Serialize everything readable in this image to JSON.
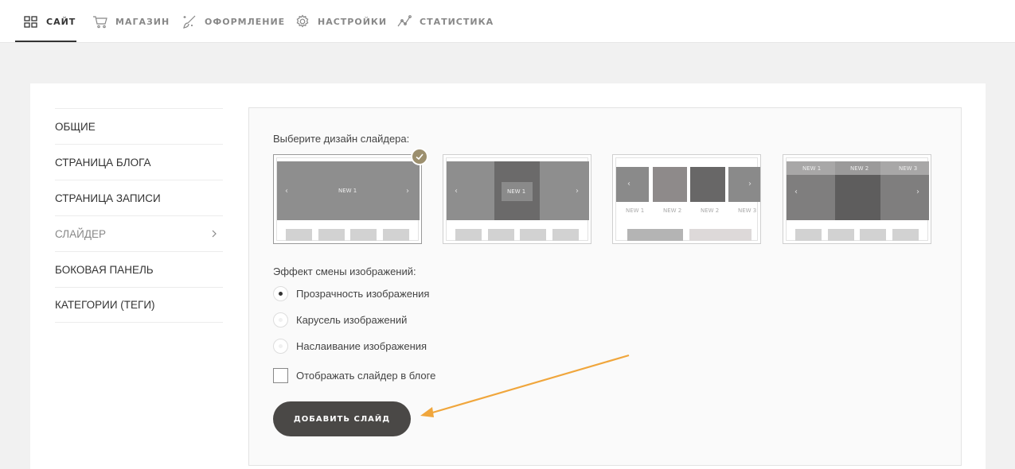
{
  "topnav": {
    "items": [
      {
        "label": "САЙТ",
        "icon": "grid-icon"
      },
      {
        "label": "МАГАЗИН",
        "icon": "cart-icon"
      },
      {
        "label": "ОФОРМЛЕНИЕ",
        "icon": "magic-brush-icon"
      },
      {
        "label": "НАСТРОЙКИ",
        "icon": "gear-icon"
      },
      {
        "label": "СТАТИСТИКА",
        "icon": "line-chart-icon"
      }
    ],
    "active": "САЙТ"
  },
  "sidebar": {
    "items": [
      {
        "label": "ОБЩИЕ"
      },
      {
        "label": "СТРАНИЦА БЛОГА"
      },
      {
        "label": "СТРАНИЦА ЗАПИСИ"
      },
      {
        "label": "СЛАЙДЕР",
        "active": true
      },
      {
        "label": "БОКОВАЯ ПАНЕЛЬ"
      },
      {
        "label": "КАТЕГОРИИ (ТЕГИ)"
      }
    ]
  },
  "panel": {
    "design_label": "Выберите дизайн слайдера:",
    "designs": [
      {
        "labels": [
          "NEW 1"
        ],
        "selected": true
      },
      {
        "labels": [
          "NEW 1"
        ]
      },
      {
        "labels": [
          "NEW 1",
          "NEW 2",
          "NEW 2",
          "NEW 3"
        ]
      },
      {
        "labels": [
          "NEW 1",
          "NEW 2",
          "NEW 3"
        ]
      }
    ],
    "effect_label": "Эффект смены изображений:",
    "effects": [
      {
        "label": "Прозрачность изображения",
        "checked": true
      },
      {
        "label": "Карусель изображений",
        "checked": false
      },
      {
        "label": "Наслаивание изображения",
        "checked": false
      }
    ],
    "show_in_blog": {
      "label": "Отображать слайдер в блоге",
      "checked": false
    },
    "add_button": "ДОБАВИТЬ СЛАЙД"
  },
  "colors": {
    "accent_check": "#9c8f6e",
    "button": "#4a4846",
    "annotation_arrow": "#f0a63c"
  }
}
